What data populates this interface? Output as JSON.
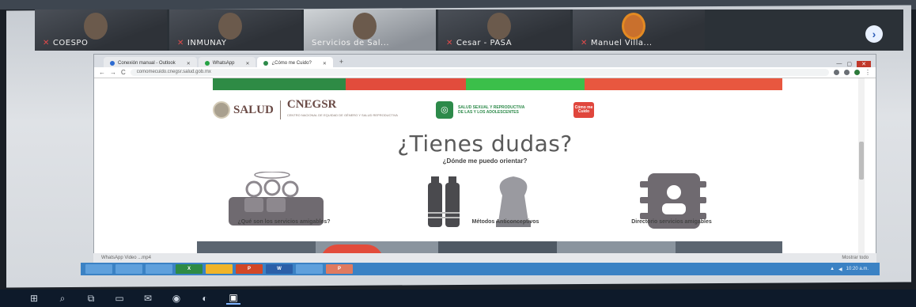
{
  "meeting": {
    "participants": [
      {
        "name": "COESPO",
        "muted": true
      },
      {
        "name": "INMUNAY",
        "muted": true
      },
      {
        "name": "Servicios de Sal...",
        "muted": false
      },
      {
        "name": "Cesar - PASA",
        "muted": true
      },
      {
        "name": "Manuel Villa...",
        "muted": true
      }
    ],
    "next_icon": "chevron-right-icon"
  },
  "browser": {
    "tabs": [
      {
        "label": "Conexión manual - Outlook",
        "active": false
      },
      {
        "label": "WhatsApp",
        "active": false
      },
      {
        "label": "¿Cómo me Cuido?",
        "active": true
      }
    ],
    "new_tab": "+",
    "address": "comomecuido.cnegsr.salud.gob.mx",
    "nav": {
      "back": "←",
      "forward": "→",
      "reload": "C"
    }
  },
  "site": {
    "colorbar": [
      "#2e8b45",
      "#e24c3c",
      "#3bbf4a",
      "#e8573f"
    ],
    "logos": {
      "salud": "SALUD",
      "cnegsr": "CNEGSR",
      "cnegsr_sub": "CENTRO NACIONAL DE EQUIDAD DE GÉNERO Y SALUD REPRODUCTIVA",
      "ssr": "SALUD SEXUAL Y REPRODUCTIVA DE LAS Y LOS ADOLESCENTES",
      "red_badge": "Cómo me Cuido"
    },
    "title": "¿Tienes dudas?",
    "subtitle": "¿Dónde me puedo orientar?",
    "cards": [
      {
        "label": "¿Qué son los servicios amigables?",
        "icon": "people-icon"
      },
      {
        "label": "Métodos Anticonceptivos",
        "icon": "contraceptive-icon"
      },
      {
        "label": "Directorio servicios amigables",
        "icon": "address-book-icon"
      }
    ]
  },
  "downloads": {
    "file": "WhatsApp Video ...mp4",
    "show_all": "Mostrar todo"
  },
  "inner_taskbar": {
    "apps": [
      "",
      "",
      "",
      "X",
      "",
      "P",
      "W",
      "",
      "P"
    ],
    "clock": "10:20 a.m."
  },
  "outer_taskbar": {
    "icons": [
      "windows-icon",
      "search-icon",
      "task-view-icon",
      "file-explorer-icon",
      "mail-icon",
      "chrome-icon",
      "edge-icon",
      "zoom-icon"
    ]
  }
}
